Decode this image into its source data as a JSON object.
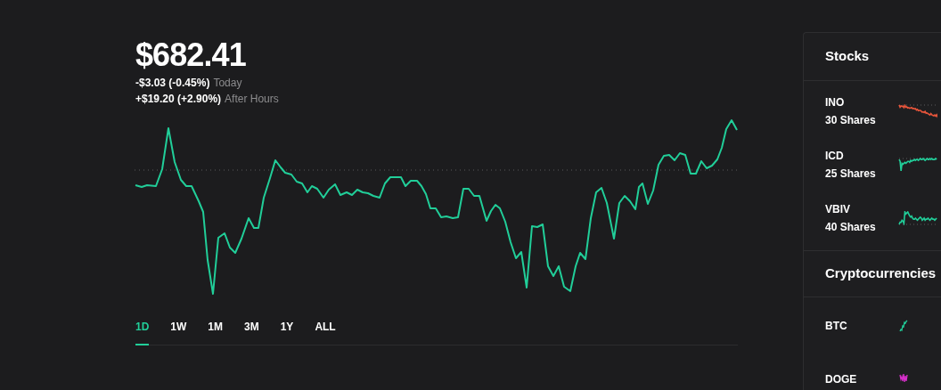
{
  "quote": {
    "price": "$682.41",
    "today_change": "-$3.03 (-0.45%)",
    "today_label": "Today",
    "after_hours_change": "+$19.20 (+2.90%)",
    "after_hours_label": "After Hours"
  },
  "ranges": [
    {
      "label": "1D",
      "selected": true
    },
    {
      "label": "1W",
      "selected": false
    },
    {
      "label": "1M",
      "selected": false
    },
    {
      "label": "3M",
      "selected": false
    },
    {
      "label": "1Y",
      "selected": false
    },
    {
      "label": "ALL",
      "selected": false
    }
  ],
  "sidebar": {
    "stocks_title": "Stocks",
    "stocks": [
      {
        "symbol": "INO",
        "shares": "30 Shares",
        "color": "#e8553b"
      },
      {
        "symbol": "ICD",
        "shares": "25 Shares",
        "color": "#21ce99"
      },
      {
        "symbol": "VBIV",
        "shares": "40 Shares",
        "color": "#21ce99"
      }
    ],
    "crypto_title": "Cryptocurrencies",
    "crypto": [
      {
        "symbol": "BTC",
        "color": "#21ce99"
      },
      {
        "symbol": "DOGE",
        "color": "#d62fc9"
      }
    ]
  }
}
